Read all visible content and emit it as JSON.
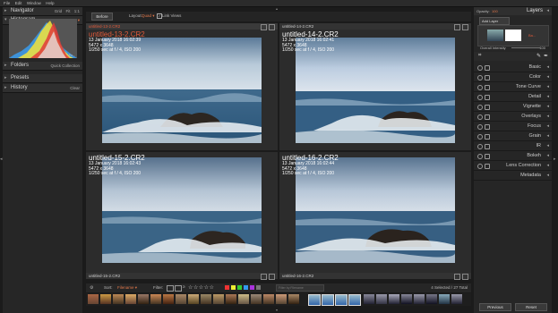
{
  "menu": [
    "File",
    "Edit",
    "Window",
    "Help"
  ],
  "navigator": {
    "title": "Navigator",
    "opts": [
      "Grid",
      "Fit",
      "1:1"
    ]
  },
  "histogram": {
    "title": "Histogram",
    "mode": "RGB ▾",
    "clip": "Pe..."
  },
  "folders": {
    "title": "Folders",
    "right": "Quick Collection"
  },
  "presets": {
    "title": "Presets"
  },
  "history": {
    "title": "History",
    "right": "Clear"
  },
  "toolbar": {
    "before": "Before",
    "layout_label": "Layout:",
    "layout_value": "Quad ▾",
    "link_views": "Link Views"
  },
  "tiles": [
    {
      "filename": "untitled-13-2.CR2",
      "title": "untitled-13-2.CR2",
      "date": "13 January 2018 16:02:39",
      "dims": "5472 x 3648",
      "exp": "1/250 sec at f / 4, ISO 200",
      "selected": true
    },
    {
      "filename": "untitled-14-2.CR2",
      "title": "untitled-14-2.CR2",
      "date": "13 January 2018 16:02:41",
      "dims": "5472 x 3648",
      "exp": "1/250 sec at f / 4, ISO 200",
      "selected": false
    },
    {
      "filename": "untitled-15-2.CR2",
      "title": "untitled-15-2.CR2",
      "date": "13 January 2018 16:02:43",
      "dims": "5472 x 3648",
      "exp": "1/250 sec at f / 4, ISO 200",
      "selected": false
    },
    {
      "filename": "untitled-16-2.CR2",
      "title": "untitled-16-2.CR2",
      "date": "13 January 2018 16:02:44",
      "dims": "5472 x 3648",
      "exp": "1/250 sec at f / 4, ISO 200",
      "selected": false
    }
  ],
  "bottombar": {
    "sort_label": "Sort:",
    "sort_value": "Filename ▾",
    "filter_label": "Filter:",
    "stars": "☆☆☆☆☆",
    "search_placeholder": "Filter by Filename",
    "status": "4 Selected / 27 Total"
  },
  "right": {
    "opacity_label": "Opacity:",
    "opacity_value": "100",
    "layers_title": "Layers",
    "add_layer": "Add Layer",
    "layer_badge": "Ba...",
    "overall": "Overall Intensity",
    "overall_value": "100",
    "adjustments": [
      "Basic",
      "Color",
      "Tone Curve",
      "Detail",
      "Vignette",
      "Overlays",
      "Focus",
      "Grain",
      "IR",
      "Bokeh",
      "Lens Correction",
      "Metadata"
    ],
    "previous": "Previous",
    "reset": "Reset"
  },
  "colors": {
    "accent": "#d9534f",
    "selected_label": "#e05a3a"
  }
}
